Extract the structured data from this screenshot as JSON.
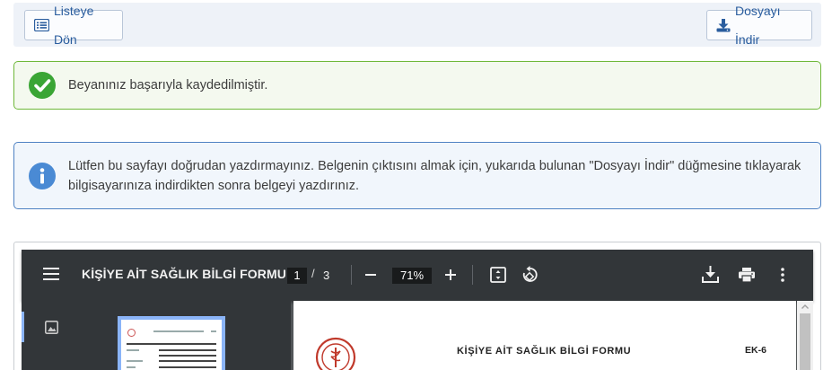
{
  "toolbar": {
    "back_label": "Listeye Dön",
    "download_label": "Dosyayı İndir"
  },
  "alerts": {
    "success_text": "Beyanınız başarıyla kaydedilmiştir.",
    "info_text": "Lütfen bu sayfayı doğrudan yazdırmayınız. Belgenin çıktısını almak için, yukarıda bulunan \"Dosyayı İndir\" düğmesine tıklayarak bilgisayarınıza indirdikten sonra belgeyi yazdırınız."
  },
  "pdf_viewer": {
    "title": "KİŞİYE AİT SAĞLIK BİLGİ FORMU",
    "current_page": "1",
    "page_separator": "/",
    "total_pages": "3",
    "zoom": "71%",
    "doc_title": "KİŞİYE AİT SAĞLIK BİLGİ FORMU",
    "annex": "EK-6",
    "icons": [
      "menu-icon",
      "zoom-out-icon",
      "zoom-in-icon",
      "fit-page-icon",
      "rotate-icon",
      "download-icon",
      "print-icon",
      "more-icon",
      "thumbnail-icon"
    ]
  },
  "colors": {
    "success_border": "#6fb83a",
    "success_icon": "#3aa535",
    "info_border": "#4f82c3",
    "info_icon": "#4a8ad4",
    "pdf_toolbar": "#323639",
    "button_text": "#2a5d9e"
  }
}
